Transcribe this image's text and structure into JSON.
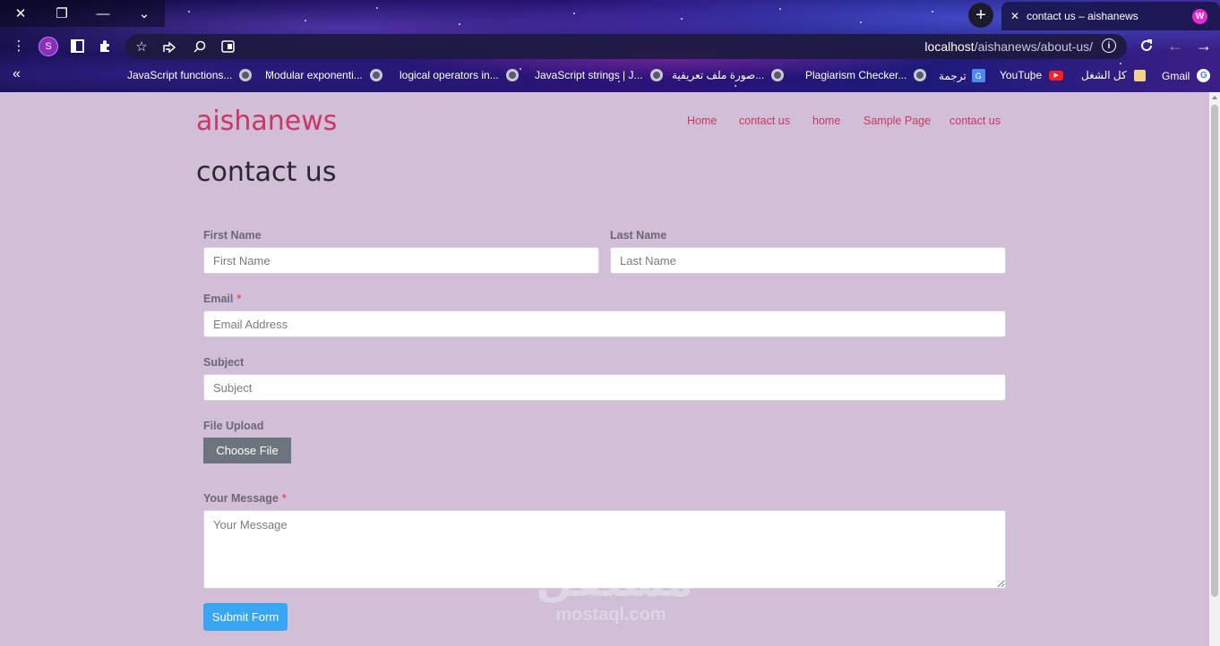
{
  "browser": {
    "window_controls": [
      "✕",
      "❐",
      "—",
      "⌄"
    ],
    "new_tab": "+",
    "tab": {
      "close": "✕",
      "title": "contact us – aishanews",
      "favicon": "W"
    },
    "profile_initial": "S",
    "url_host": "localhost",
    "url_path": "/aishanews/about-us/",
    "bookmarks_more": "«",
    "bookmarks": [
      {
        "label": "JavaScript functions...",
        "icon": "globe-icon"
      },
      {
        "label": "Modular exponenti...",
        "icon": "globe-icon"
      },
      {
        "label": "logical operators in...",
        "icon": "globe-icon"
      },
      {
        "label": "JavaScript strings | J...",
        "icon": "globe-icon"
      },
      {
        "label": "صورة ملف تعريفية...",
        "icon": "globe-icon"
      },
      {
        "label": "Plagiarism Checker...",
        "icon": "globe-icon"
      },
      {
        "label": "ترجمة",
        "icon": "translate-icon"
      },
      {
        "label": "YouTube",
        "icon": "youtube-icon"
      },
      {
        "label": "كل الشغل",
        "icon": "folder-icon"
      },
      {
        "label": "Gmail",
        "icon": "google-icon"
      }
    ]
  },
  "site": {
    "title": "aishanews",
    "menu": [
      "Home",
      "contact us",
      "home",
      "Sample Page",
      "contact us"
    ]
  },
  "page": {
    "title": "contact us"
  },
  "form": {
    "first_name": {
      "label": "First Name",
      "placeholder": "First Name"
    },
    "last_name": {
      "label": "Last Name",
      "placeholder": "Last Name"
    },
    "email": {
      "label": "Email",
      "required_mark": "*",
      "placeholder": "Email Address"
    },
    "subject": {
      "label": "Subject",
      "placeholder": "Subject"
    },
    "file_upload": {
      "label": "File Upload",
      "button": "Choose File"
    },
    "message": {
      "label": "Your Message",
      "required_mark": "*",
      "placeholder": "Your Message"
    },
    "submit": "Submit Form"
  },
  "watermark": {
    "arabic": "مستقل",
    "latin": "mostaql.com"
  },
  "colors": {
    "page_bg": "#d0bfd6",
    "accent": "#cc3566",
    "submit": "#39a6f3",
    "file_button": "#6c757d"
  }
}
